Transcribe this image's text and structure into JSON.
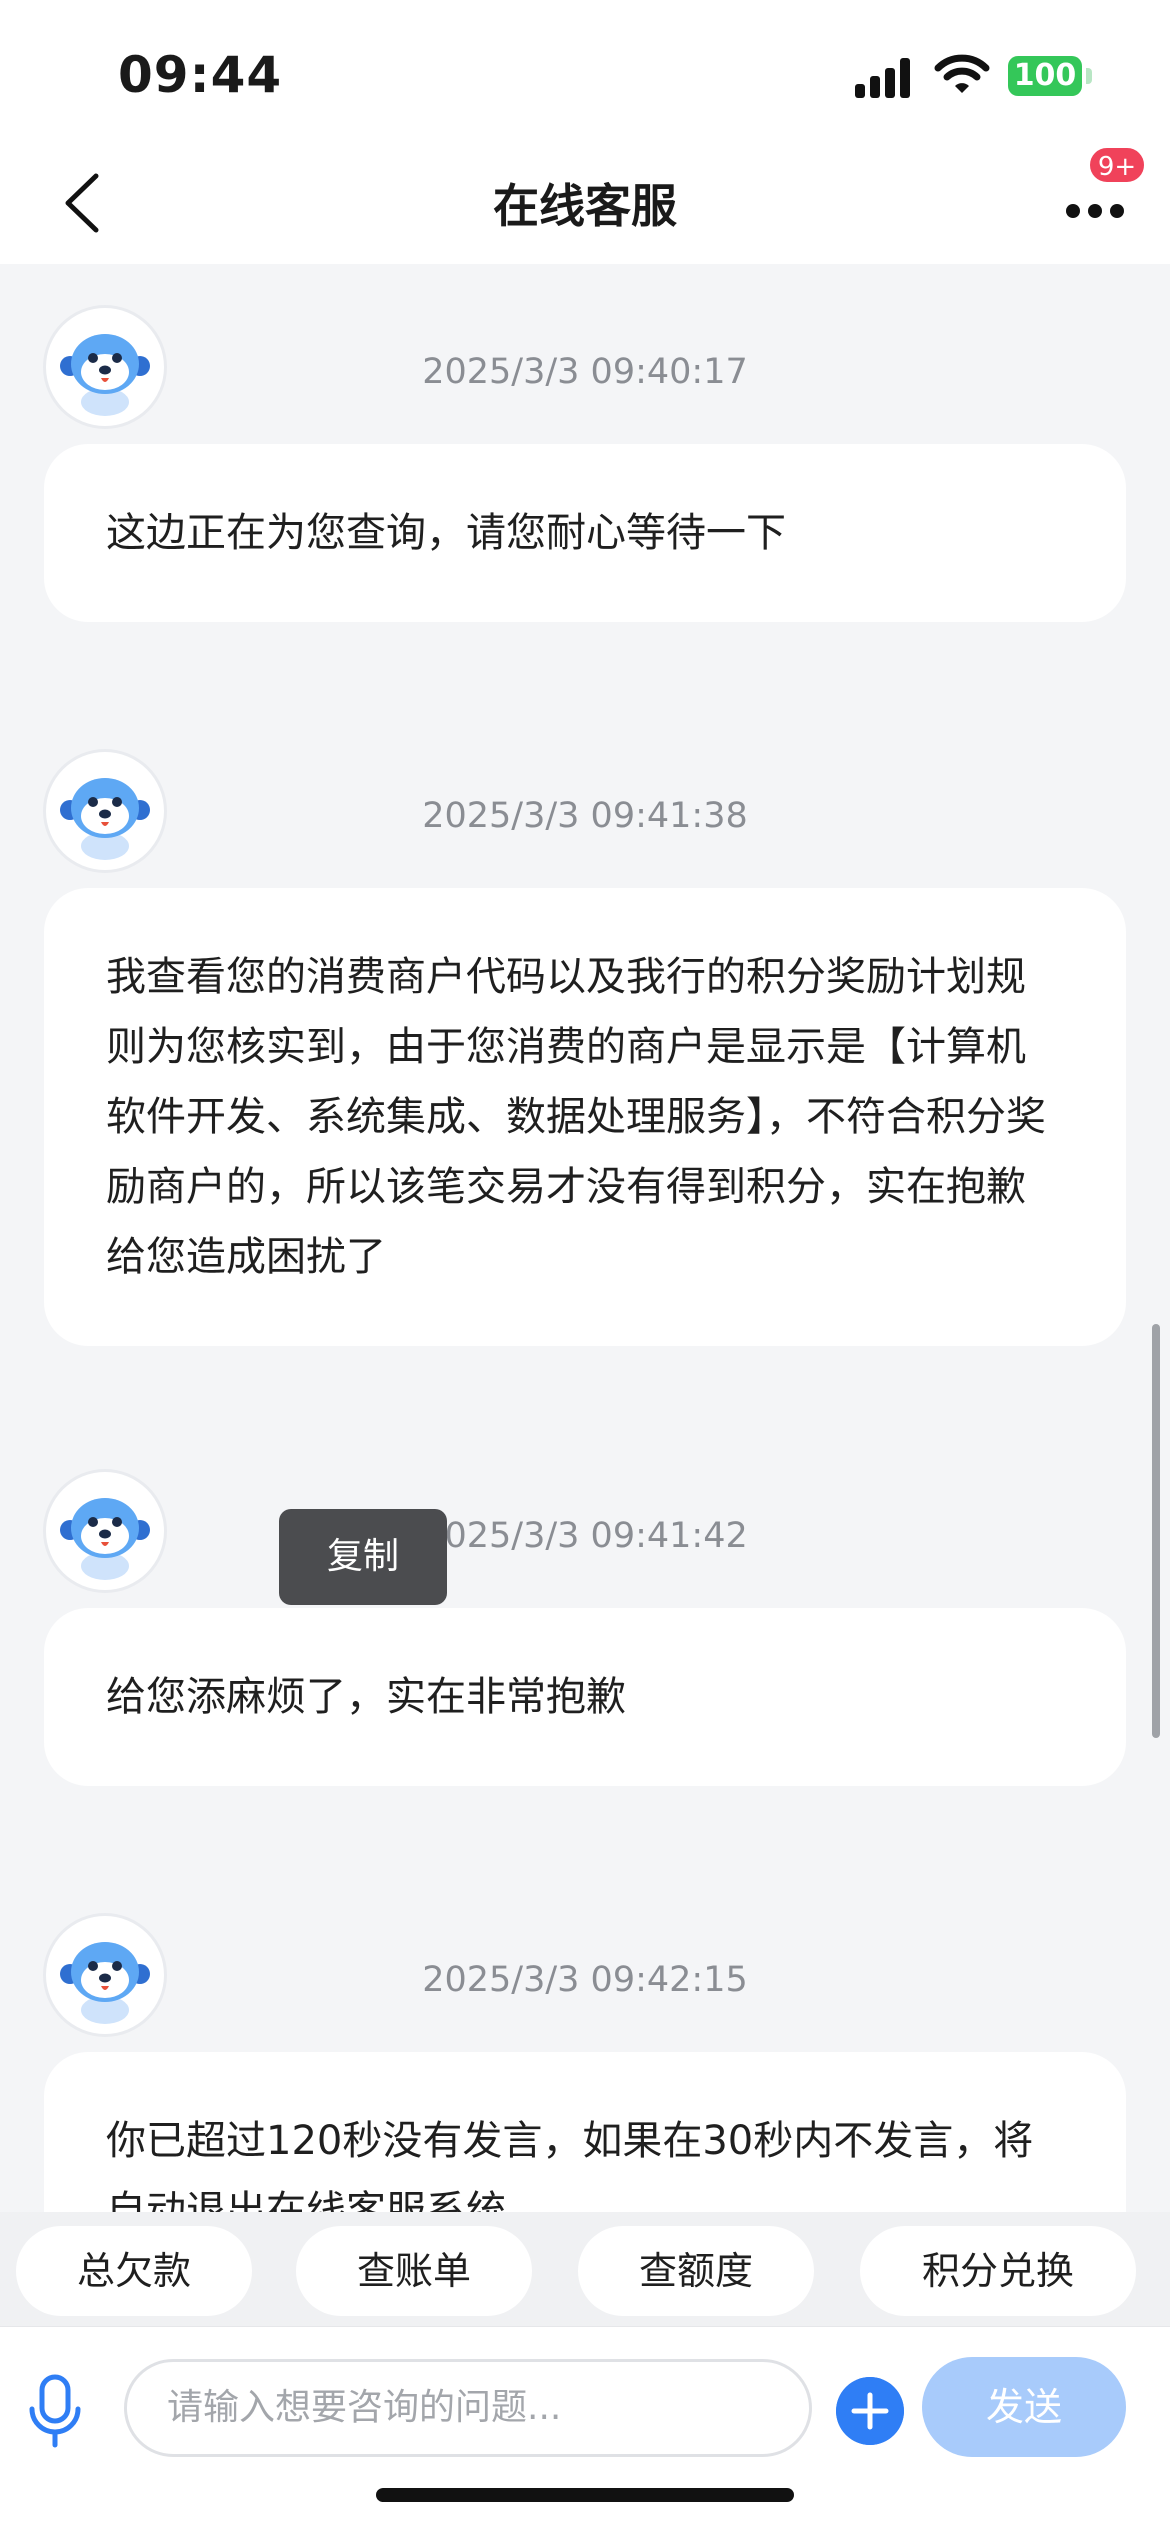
{
  "status_bar": {
    "time": "09:44",
    "battery": "100"
  },
  "header": {
    "title": "在线客服",
    "badge": "9+"
  },
  "messages": [
    {
      "timestamp": "2025/3/3 09:40:17",
      "text": "这边正在为您查询，请您耐心等待一下"
    },
    {
      "timestamp": "2025/3/3 09:41:38",
      "text": "我查看您的消费商户代码以及我行的积分奖励计划规则为您核实到，由于您消费的商户是显示是【计算机软件开发、系统集成、数据处理服务】，不符合积分奖励商户的，所以该笔交易才没有得到积分，实在抱歉给您造成困扰了"
    },
    {
      "timestamp": "2025/3/3 09:41:42",
      "text": "给您添麻烦了，实在非常抱歉"
    },
    {
      "timestamp": "2025/3/3 09:42:15",
      "text": "你已超过120秒没有发言，如果在30秒内不发言，将自动退出在线客服系统"
    }
  ],
  "context_menu": {
    "copy": "复制"
  },
  "quick_actions": [
    "总欠款",
    "查账单",
    "查额度",
    "积分兑换"
  ],
  "composer": {
    "placeholder": "请输入想要咨询的问题...",
    "send": "发送"
  },
  "icons": {
    "back": "chevron-left-icon",
    "more": "more-dots-icon",
    "mic": "microphone-icon",
    "plus": "plus-circle-icon",
    "avatar": "robot-dog-avatar"
  },
  "colors": {
    "accent": "#2f7ef5",
    "send_disabled": "#a8cbfb",
    "badge": "#f0425a",
    "battery": "#34c759"
  }
}
